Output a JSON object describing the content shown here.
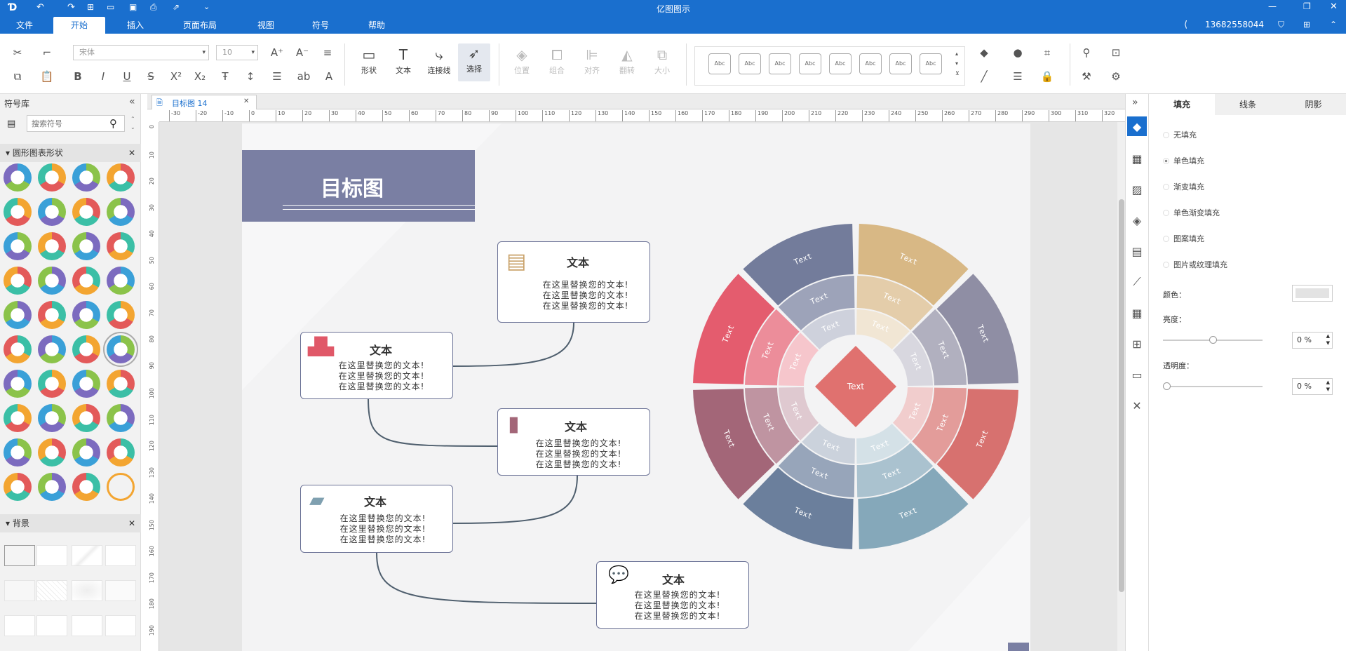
{
  "window": {
    "title": "亿图图示",
    "user": "13682558044"
  },
  "menu": [
    "文件",
    "开始",
    "插入",
    "页面布局",
    "视图",
    "符号",
    "帮助"
  ],
  "ribbon": {
    "font_name": "宋体",
    "font_size": "10",
    "tools": {
      "shape": "形状",
      "text": "文本",
      "connector": "连接线",
      "select": "选择"
    },
    "arrange": {
      "position": "位置",
      "group": "组合",
      "align": "对齐",
      "flip": "翻转",
      "size": "大小"
    },
    "style_swatches": [
      "Abc",
      "Abc",
      "Abc",
      "Abc",
      "Abc",
      "Abc",
      "Abc",
      "Abc"
    ]
  },
  "library": {
    "title": "符号库",
    "search_placeholder": "搜索符号",
    "section1": "圆形图表形状",
    "section2": "背景"
  },
  "doc_tab": "目标图 14",
  "ruler_h": [
    "-30",
    "-20",
    "-10",
    "0",
    "10",
    "20",
    "30",
    "40",
    "50",
    "60",
    "70",
    "80",
    "90",
    "100",
    "110",
    "120",
    "130",
    "140",
    "150",
    "160",
    "170",
    "180",
    "190",
    "200",
    "210",
    "220",
    "230",
    "240",
    "250",
    "260",
    "270",
    "280",
    "290",
    "300",
    "310",
    "320"
  ],
  "ruler_v": [
    "0",
    "10",
    "20",
    "30",
    "40",
    "50",
    "60",
    "70",
    "80",
    "90",
    "100",
    "110",
    "120",
    "130",
    "140",
    "150",
    "160",
    "170",
    "180",
    "190"
  ],
  "diagram": {
    "title": "目标图",
    "cards": [
      {
        "title": "文本",
        "lines": [
          "在这里替换您的文本!",
          "在这里替换您的文本!",
          "在这里替换您的文本!"
        ]
      },
      {
        "title": "文本",
        "lines": [
          "在这里替换您的文本!",
          "在这里替换您的文本!",
          "在这里替换您的文本!"
        ]
      },
      {
        "title": "文本",
        "lines": [
          "在这里替换您的文本!",
          "在这里替换您的文本!",
          "在这里替换您的文本!"
        ]
      },
      {
        "title": "文本",
        "lines": [
          "在这里替换您的文本!",
          "在这里替换您的文本!",
          "在这里替换您的文本!"
        ]
      },
      {
        "title": "文本",
        "lines": [
          "在这里替换您的文本!",
          "在这里替换您的文本!",
          "在这里替换您的文本!"
        ]
      }
    ],
    "center_label": "Text",
    "segment_label": "Text",
    "colors": {
      "header_bg": "#7a7fa3",
      "top_left": "#737c9b",
      "top_right": "#d8b885",
      "right_top": "#8f8ea4",
      "right_bottom": "#d7716f",
      "bottom_right": "#85a8ba",
      "bottom_left": "#6b7f9c",
      "left_bottom": "#a36678",
      "left_top": "#e45c6e",
      "center": "#e0716f"
    }
  },
  "right_panel": {
    "tabs": [
      "填充",
      "线条",
      "阴影"
    ],
    "fill_options": [
      "无填充",
      "单色填充",
      "渐变填充",
      "单色渐变填充",
      "图案填充",
      "图片或纹理填充"
    ],
    "color_label": "颜色：",
    "brightness_label": "亮度：",
    "brightness_value": "0 %",
    "transparency_label": "透明度：",
    "transparency_value": "0 %"
  }
}
